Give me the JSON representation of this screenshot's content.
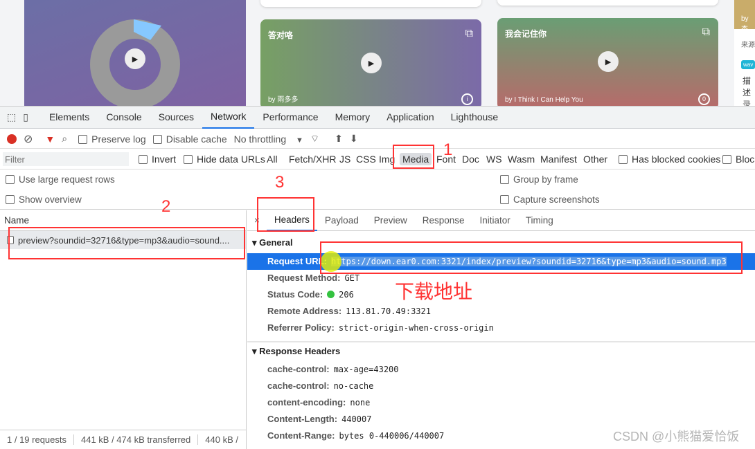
{
  "webpage": {
    "cards": [
      {
        "title": "答对咯",
        "by": "by 雨多多"
      },
      {
        "title": "我会记住你",
        "by": "by I Think I Can Help You"
      }
    ],
    "side_texts": [
      "by 杰",
      "来源",
      "wav",
      "描述",
      "录制"
    ]
  },
  "devtools": {
    "tabs": [
      "Elements",
      "Console",
      "Sources",
      "Network",
      "Performance",
      "Memory",
      "Application",
      "Lighthouse"
    ],
    "active_tab": "Network",
    "toolbar": {
      "preserve_log": "Preserve log",
      "disable_cache": "Disable cache",
      "throttling": "No throttling"
    },
    "filter": {
      "placeholder": "Filter",
      "invert": "Invert",
      "hide_data_urls": "Hide data URLs",
      "types": [
        "All",
        "Fetch/XHR",
        "JS",
        "CSS",
        "Img",
        "Media",
        "Font",
        "Doc",
        "WS",
        "Wasm",
        "Manifest",
        "Other"
      ],
      "active_type": "Media",
      "has_blocked_cookies": "Has blocked cookies",
      "blocked": "Bloc"
    },
    "options": {
      "large_rows": "Use large request rows",
      "show_overview": "Show overview",
      "group_by_frame": "Group by frame",
      "capture_screenshots": "Capture screenshots"
    },
    "list": {
      "header": "Name",
      "requests": [
        "preview?soundid=32716&type=mp3&audio=sound...."
      ]
    },
    "status": {
      "requests": "1 / 19 requests",
      "transferred": "441 kB / 474 kB transferred",
      "resources": "440 kB /"
    },
    "detail_tabs": [
      "Headers",
      "Payload",
      "Preview",
      "Response",
      "Initiator",
      "Timing"
    ],
    "general": {
      "title": "General",
      "rows": [
        {
          "k": "Request URL:",
          "v": "https://down.ear0.com:3321/index/preview?soundid=32716&type=mp3&audio=sound.mp3"
        },
        {
          "k": "Request Method:",
          "v": "GET"
        },
        {
          "k": "Status Code:",
          "v": "206"
        },
        {
          "k": "Remote Address:",
          "v": "113.81.70.49:3321"
        },
        {
          "k": "Referrer Policy:",
          "v": "strict-origin-when-cross-origin"
        }
      ]
    },
    "response_headers": {
      "title": "Response Headers",
      "rows": [
        {
          "k": "cache-control:",
          "v": "max-age=43200"
        },
        {
          "k": "cache-control:",
          "v": "no-cache"
        },
        {
          "k": "content-encoding:",
          "v": "none"
        },
        {
          "k": "Content-Length:",
          "v": "440007"
        },
        {
          "k": "Content-Range:",
          "v": "bytes 0-440006/440007"
        }
      ]
    }
  },
  "annotations": {
    "n1": "1",
    "n2": "2",
    "n3": "3",
    "label": "下载地址"
  },
  "watermark": "CSDN @小熊猫爱恰饭"
}
